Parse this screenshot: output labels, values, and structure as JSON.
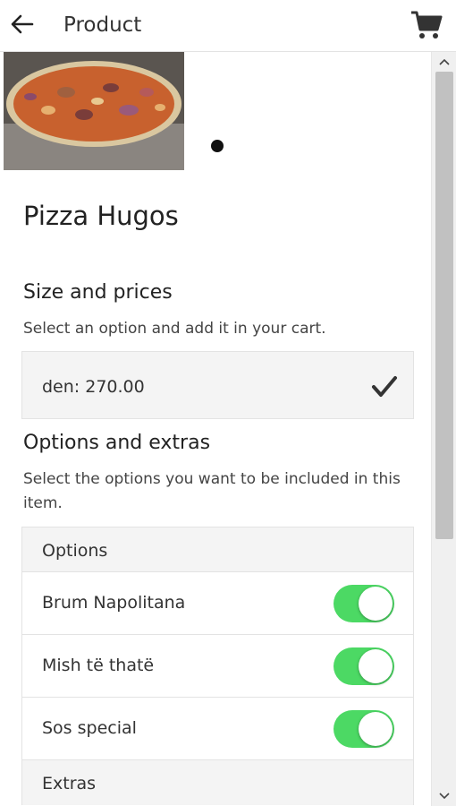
{
  "header": {
    "title": "Product",
    "back_icon": "arrow-left-icon",
    "cart_icon": "shopping-cart-icon"
  },
  "product": {
    "name": "Pizza Hugos"
  },
  "size_section": {
    "title": "Size and prices",
    "subtitle": "Select an option and add it in your cart.",
    "price_option": "den: 270.00",
    "selected": true
  },
  "options_section": {
    "title": "Options and extras",
    "subtitle": "Select the options you want to be included in this item.",
    "options_header": "Options",
    "options": [
      {
        "label": "Brum Napolitana",
        "enabled": true
      },
      {
        "label": "Mish të thatë",
        "enabled": true
      },
      {
        "label": "Sos special",
        "enabled": true
      }
    ],
    "extras_header": "Extras"
  },
  "colors": {
    "toggle_on": "#4cd964",
    "row_bg": "#f4f4f4",
    "scrollbar_thumb": "#c1c1c1"
  }
}
